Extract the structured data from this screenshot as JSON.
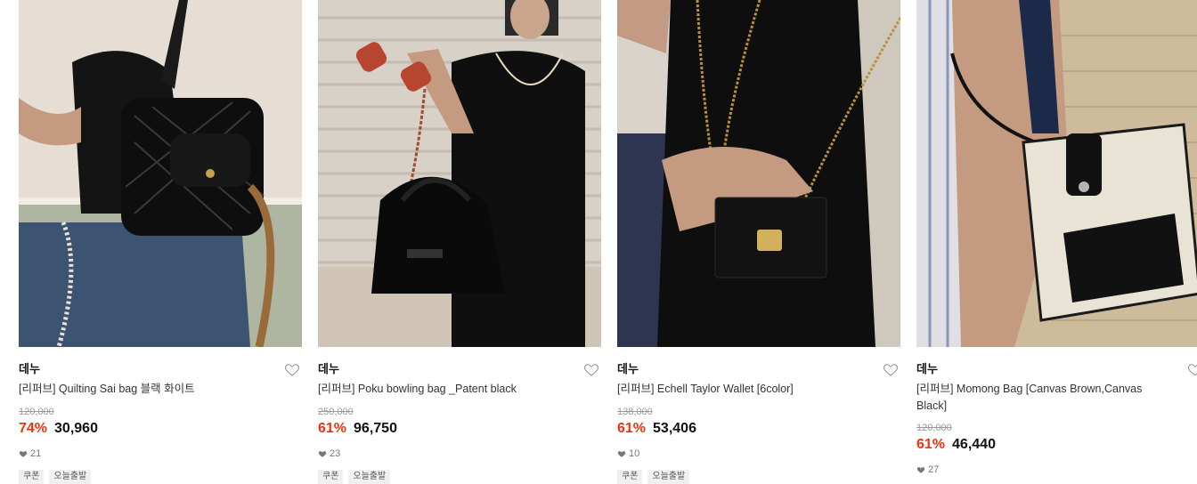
{
  "products": [
    {
      "brand": "데누",
      "name": "[리퍼브] Quilting Sai bag 블랙 화이트",
      "original_price": "120,000",
      "discount": "74%",
      "sale_price": "30,960",
      "likes": "21",
      "tags": [
        "쿠폰",
        "오늘출발"
      ]
    },
    {
      "brand": "데누",
      "name": "[리퍼브] Poku bowling bag _Patent black",
      "original_price": "250,000",
      "discount": "61%",
      "sale_price": "96,750",
      "likes": "23",
      "tags": [
        "쿠폰",
        "오늘출발"
      ]
    },
    {
      "brand": "데누",
      "name": "[리퍼브] Echell Taylor Wallet [6color]",
      "original_price": "138,000",
      "discount": "61%",
      "sale_price": "53,406",
      "likes": "10",
      "tags": [
        "쿠폰",
        "오늘출발"
      ]
    },
    {
      "brand": "데누",
      "name": "[리퍼브] Momong Bag [Canvas Brown,Canvas Black]",
      "original_price": "120,000",
      "discount": "61%",
      "sale_price": "46,440",
      "likes": "27",
      "tags": []
    }
  ],
  "colors": {
    "discount": "#f0330f",
    "price": "#111111",
    "strike": "#9a9a9a"
  }
}
